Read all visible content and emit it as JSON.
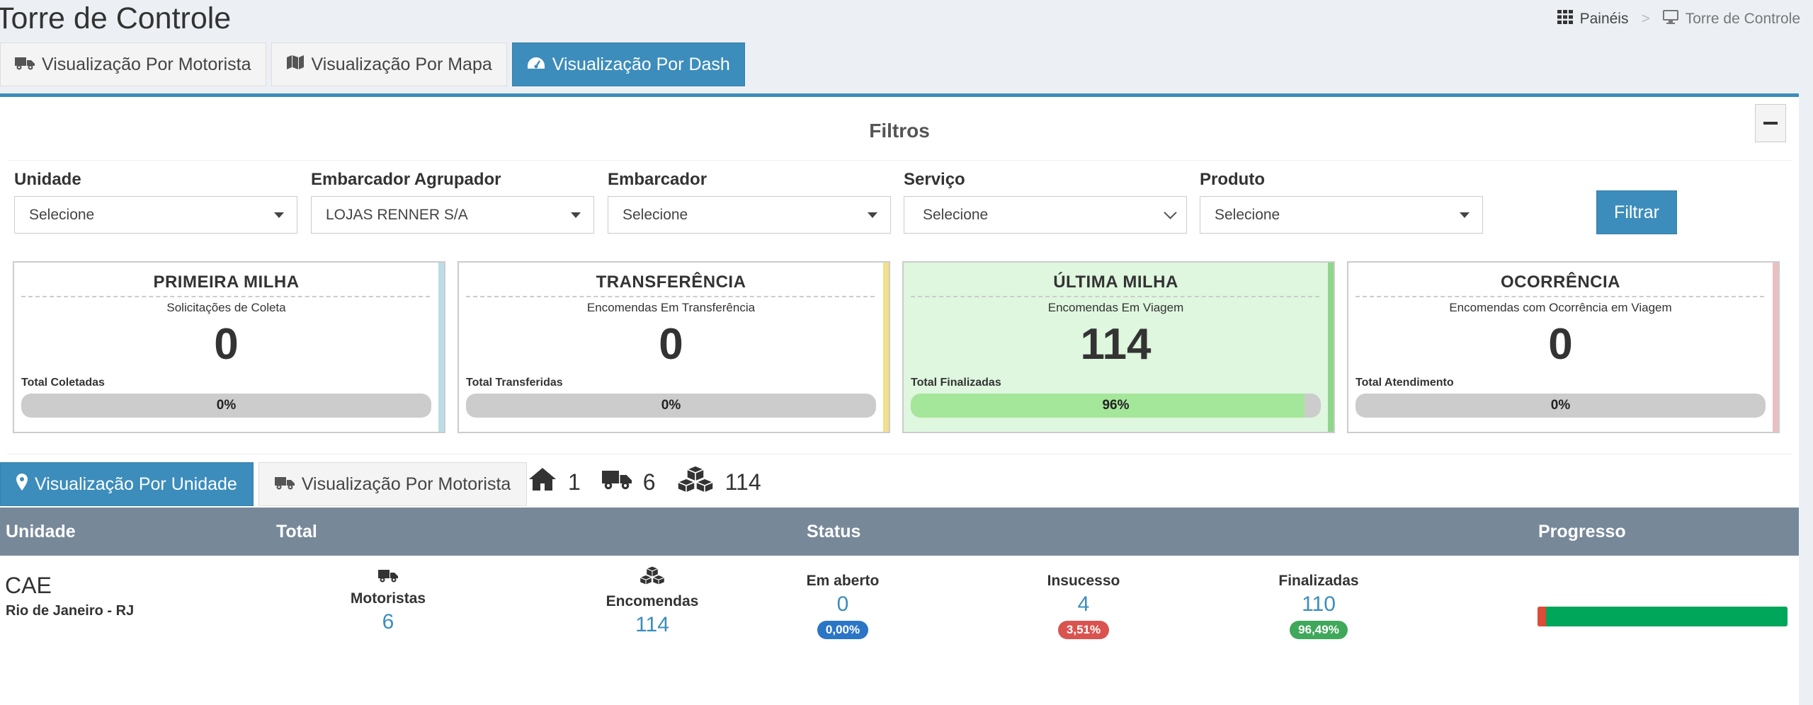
{
  "page": {
    "title": "Torre de Controle"
  },
  "breadcrumb": {
    "home": "Painéis",
    "current": "Torre de Controle"
  },
  "top_tabs": [
    {
      "label": "Visualização Por Motorista",
      "icon": "truck-icon",
      "active": false
    },
    {
      "label": "Visualização Por Mapa",
      "icon": "map-icon",
      "active": false
    },
    {
      "label": "Visualização Por Dash",
      "icon": "dashboard-icon",
      "active": true
    }
  ],
  "filters": {
    "title": "Filtros",
    "fields": [
      {
        "label": "Unidade",
        "value": "Selecione"
      },
      {
        "label": "Embarcador Agrupador",
        "value": "LOJAS RENNER S/A"
      },
      {
        "label": "Embarcador",
        "value": "Selecione"
      },
      {
        "label": "Serviço",
        "value": "Selecione"
      },
      {
        "label": "Produto",
        "value": "Selecione"
      }
    ],
    "button": "Filtrar"
  },
  "cards": [
    {
      "title": "PRIMEIRA MILHA",
      "subtitle": "Solicitações de Coleta",
      "value": "0",
      "footer": "Total Coletadas",
      "percent": "0%",
      "progress": 0,
      "strip_color": "#bcdde6",
      "highlight": false
    },
    {
      "title": "TRANSFERÊNCIA",
      "subtitle": "Encomendas Em Transferência",
      "value": "0",
      "footer": "Total Transferidas",
      "percent": "0%",
      "progress": 0,
      "strip_color": "#f2e08a",
      "highlight": false
    },
    {
      "title": "ÚLTIMA MILHA",
      "subtitle": "Encomendas Em Viagem",
      "value": "114",
      "footer": "Total Finalizadas",
      "percent": "96%",
      "progress": 96,
      "strip_color": "#8fd68a",
      "highlight": true
    },
    {
      "title": "OCORRÊNCIA",
      "subtitle": "Encomendas com Ocorrência em Viagem",
      "value": "0",
      "footer": "Total Atendimento",
      "percent": "0%",
      "progress": 0,
      "strip_color": "#e8c0c0",
      "highlight": false
    }
  ],
  "bottom_tabs": [
    {
      "label": "Visualização Por Unidade",
      "icon": "map-marker-icon",
      "active": true
    },
    {
      "label": "Visualização Por Motorista",
      "icon": "truck-icon",
      "active": false
    }
  ],
  "counts": {
    "units": "1",
    "drivers": "6",
    "packages": "114"
  },
  "table": {
    "headers": {
      "unidade": "Unidade",
      "total": "Total",
      "status": "Status",
      "progresso": "Progresso"
    },
    "row": {
      "unit": "CAE",
      "city": "Rio de Janeiro - RJ",
      "motoristas_label": "Motoristas",
      "motoristas": "6",
      "encomendas_label": "Encomendas",
      "encomendas": "114",
      "em_aberto_label": "Em aberto",
      "em_aberto": "0",
      "em_aberto_pct": "0,00%",
      "insucesso_label": "Insucesso",
      "insucesso": "4",
      "insucesso_pct": "3,51%",
      "finalizadas_label": "Finalizadas",
      "finalizadas": "110",
      "finalizadas_pct": "96,49%",
      "progress_fail": 3.51,
      "progress_done": 96.49
    }
  },
  "colors": {
    "primary": "#3c8dbc",
    "success": "#00a65a",
    "danger": "#dd4b39",
    "header": "#778899",
    "badge_blue": "#2b75c6",
    "badge_red": "#d9534f",
    "badge_green": "#3fa85a"
  }
}
